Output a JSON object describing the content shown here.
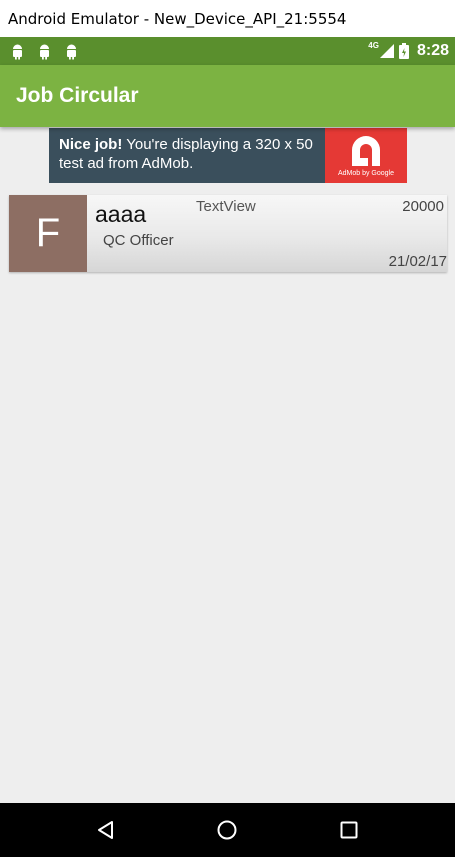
{
  "window": {
    "title": "Android Emulator - New_Device_API_21:5554"
  },
  "statusbar": {
    "network": "4G",
    "time": "8:28",
    "colors": {
      "background": "#5a8f2d"
    }
  },
  "appbar": {
    "title": "Job Circular",
    "color": "#7cb342"
  },
  "ad": {
    "bold_text": "Nice job!",
    "text": " You're displaying a 320 x 50 test ad from AdMob.",
    "logo_caption": "AdMob by Google",
    "colors": {
      "background": "#3a4f5c",
      "logo": "#e53935"
    }
  },
  "jobs": [
    {
      "avatar_letter": "F",
      "title": "aaaa",
      "extra": "TextView",
      "salary": "20000",
      "position": "QC Officer",
      "date": "21/02/17",
      "avatar_color": "#8d6e63"
    }
  ],
  "navbar": {
    "icons": [
      "back-icon",
      "home-icon",
      "recents-icon"
    ]
  }
}
